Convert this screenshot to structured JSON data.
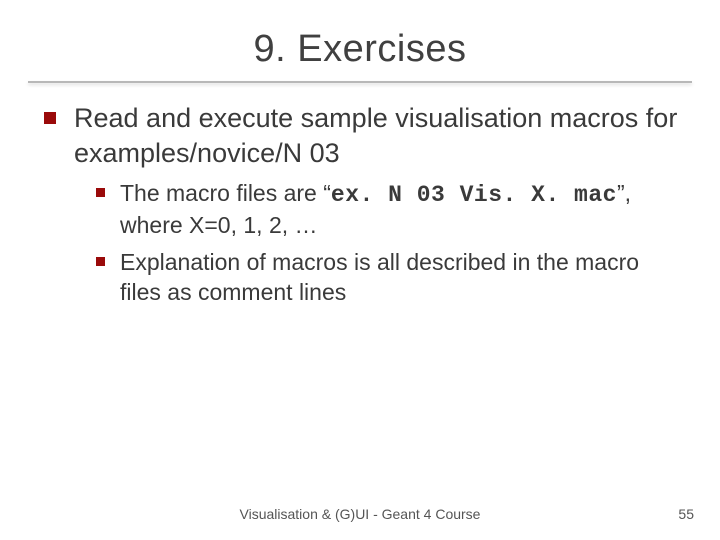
{
  "title": "9. Exercises",
  "bullets": {
    "main": "Read and execute sample visualisation macros for examples/novice/N 03",
    "sub1_pre": "The macro files are “",
    "sub1_code": "ex. N 03 Vis. X. mac",
    "sub1_post": "”, where   X=0, 1, 2, …",
    "sub2": "Explanation of macros is all described in the  macro files as comment lines"
  },
  "footer": {
    "center": "Visualisation & (G)UI - Geant 4 Course",
    "page": "55"
  }
}
